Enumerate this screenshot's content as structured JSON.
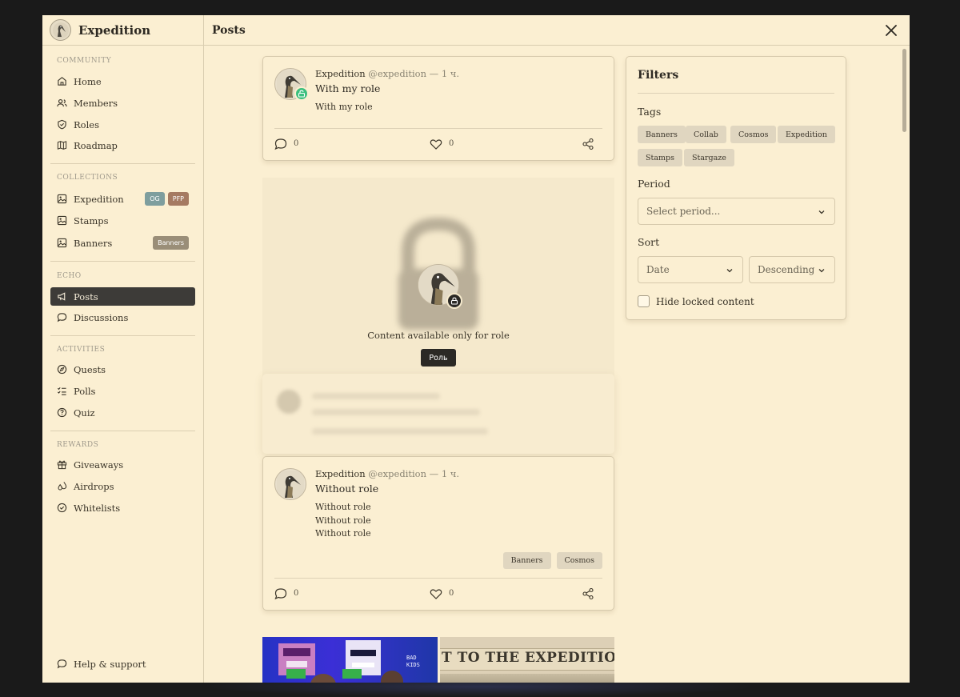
{
  "app": {
    "name": "Expedition",
    "page_title": "Posts"
  },
  "sidebar": {
    "sections": [
      {
        "label": "COMMUNITY",
        "items": [
          "Home",
          "Members",
          "Roles",
          "Roadmap"
        ]
      },
      {
        "label": "COLLECTIONS",
        "items": [
          "Expedition",
          "Stamps",
          "Banners"
        ]
      },
      {
        "label": "ECHO",
        "items": [
          "Posts",
          "Discussions"
        ]
      },
      {
        "label": "ACTIVITIES",
        "items": [
          "Quests",
          "Polls",
          "Quiz"
        ]
      },
      {
        "label": "REWARDS",
        "items": [
          "Giveaways",
          "Airdrops",
          "Whitelists"
        ]
      }
    ],
    "badges": {
      "og": "OG",
      "pfp": "PFP",
      "banners": "Banners"
    },
    "help": "Help & support",
    "active": "Posts"
  },
  "posts": [
    {
      "author": "Expedition",
      "handle": "@expedition",
      "time": "— 1 ч.",
      "title": "With my role",
      "body": [
        "With my role"
      ],
      "comments": "0",
      "likes": "0",
      "tags": []
    },
    {
      "author": "Expedition",
      "handle": "@expedition",
      "time": "— 1 ч.",
      "title": "Without role",
      "body": [
        "Without role",
        "Without role",
        "Without role"
      ],
      "comments": "0",
      "likes": "0",
      "tags": [
        "Banners",
        "Cosmos"
      ]
    }
  ],
  "locked": {
    "message": "Content available only for role",
    "role_button": "Роль"
  },
  "media": {
    "banner_text": "T TO THE EXPEDITION",
    "bad_kids": "BAD KIDS"
  },
  "filters": {
    "title": "Filters",
    "tags_label": "Tags",
    "tags": [
      "Banners",
      "Collab",
      "Cosmos",
      "Expedition",
      "Stamps",
      "Stargaze"
    ],
    "period_label": "Period",
    "period_placeholder": "Select period...",
    "sort_label": "Sort",
    "sort_field": "Date",
    "sort_order": "Descending",
    "hide_locked": "Hide locked content"
  },
  "colors": {
    "accent_active": "#3d3b38",
    "unlock_green": "#3cbf7e",
    "background": "#fbefd2"
  }
}
